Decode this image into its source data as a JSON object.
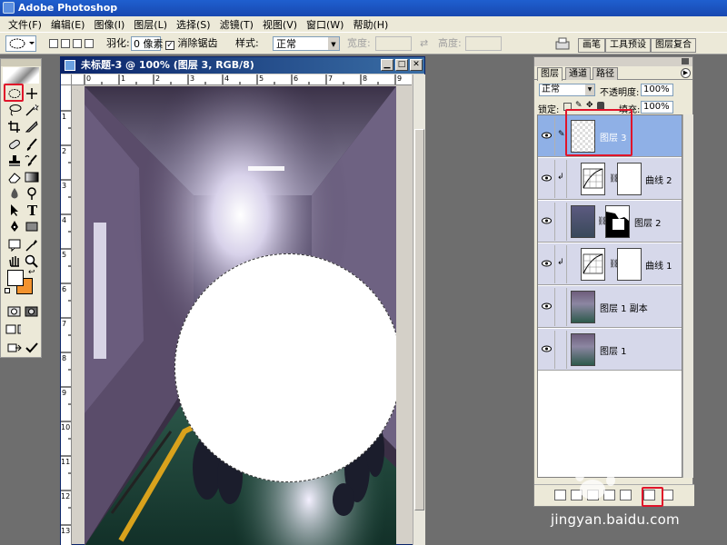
{
  "app": {
    "title": "Adobe Photoshop"
  },
  "menu": [
    "文件(F)",
    "编辑(E)",
    "图像(I)",
    "图层(L)",
    "选择(S)",
    "滤镜(T)",
    "视图(V)",
    "窗口(W)",
    "帮助(H)"
  ],
  "options": {
    "feather_label": "羽化:",
    "feather_value": "0 像素",
    "antialias_label": "消除锯齿",
    "antialias_checked": true,
    "style_label": "样式:",
    "style_value": "正常",
    "width_label": "宽度:",
    "height_label": "高度:"
  },
  "palette_well": [
    "画笔",
    "工具预设",
    "图层复合"
  ],
  "document": {
    "title": "未标题-3 @ 100% (图层 3, RGB/8)",
    "ruler_top": [
      "0",
      "1",
      "2",
      "3",
      "4",
      "5",
      "6",
      "7",
      "8",
      "9"
    ],
    "ruler_left": [
      "1",
      "2",
      "3",
      "4",
      "5",
      "6",
      "7",
      "8",
      "9",
      "10",
      "11",
      "12",
      "13"
    ]
  },
  "layers_panel": {
    "tabs": [
      "图层",
      "通道",
      "路径"
    ],
    "blend_mode": "正常",
    "opacity_label": "不透明度:",
    "opacity_value": "100%",
    "lock_label": "锁定:",
    "fill_label": "填充:",
    "fill_value": "100%",
    "layers": [
      {
        "name": "图层 3",
        "selected": true,
        "type": "white"
      },
      {
        "name": "曲线 2",
        "selected": false,
        "type": "curves"
      },
      {
        "name": "图层 2",
        "selected": false,
        "type": "photo-mask"
      },
      {
        "name": "曲线 1",
        "selected": false,
        "type": "curves"
      },
      {
        "name": "图层 1 副本",
        "selected": false,
        "type": "photo"
      },
      {
        "name": "图层 1",
        "selected": false,
        "type": "photo"
      }
    ]
  },
  "watermark": "jingyan.baidu.com",
  "colors": {
    "foreground": "#ffffff",
    "background": "#f2922e",
    "highlight": "#e0142a",
    "selected_layer": "#8fb0e6"
  }
}
